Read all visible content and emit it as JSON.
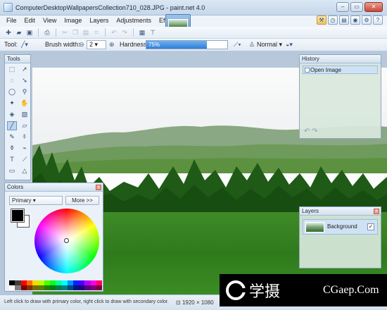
{
  "window": {
    "title": "ComputerDesktopWallpapersCollection710_028.JPG - paint.net 4.0",
    "controls": {
      "help": "?",
      "minimize": "–",
      "maximize": "▭",
      "close": "✕"
    }
  },
  "menu": {
    "items": [
      "File",
      "Edit",
      "View",
      "Image",
      "Layers",
      "Adjustments",
      "Effects"
    ]
  },
  "toolbar": {
    "tool_label": "Tool:",
    "brush_width_label": "Brush width:",
    "brush_width_value": "2",
    "hardness_label": "Hardness:",
    "hardness_value": "75%",
    "hardness_percent": 75,
    "blend_mode": "Normal"
  },
  "panels": {
    "tools": {
      "title": "Tools"
    },
    "colors": {
      "title": "Colors",
      "mode": "Primary",
      "more_button": "More >>"
    },
    "history": {
      "title": "History",
      "items": [
        "Open Image"
      ]
    },
    "layers": {
      "title": "Layers",
      "items": [
        {
          "name": "Background",
          "visible": true
        }
      ]
    }
  },
  "status": {
    "hint": "Left click to draw with primary color, right click to draw with secondary color.",
    "image_size": "1920 × 1080"
  },
  "colors": {
    "accent": "#3c8dde",
    "primary_color": "#000000",
    "secondary_color": "#ffffff"
  },
  "watermark": {
    "logo_text": "学摄",
    "site": "CGaep.Com"
  }
}
